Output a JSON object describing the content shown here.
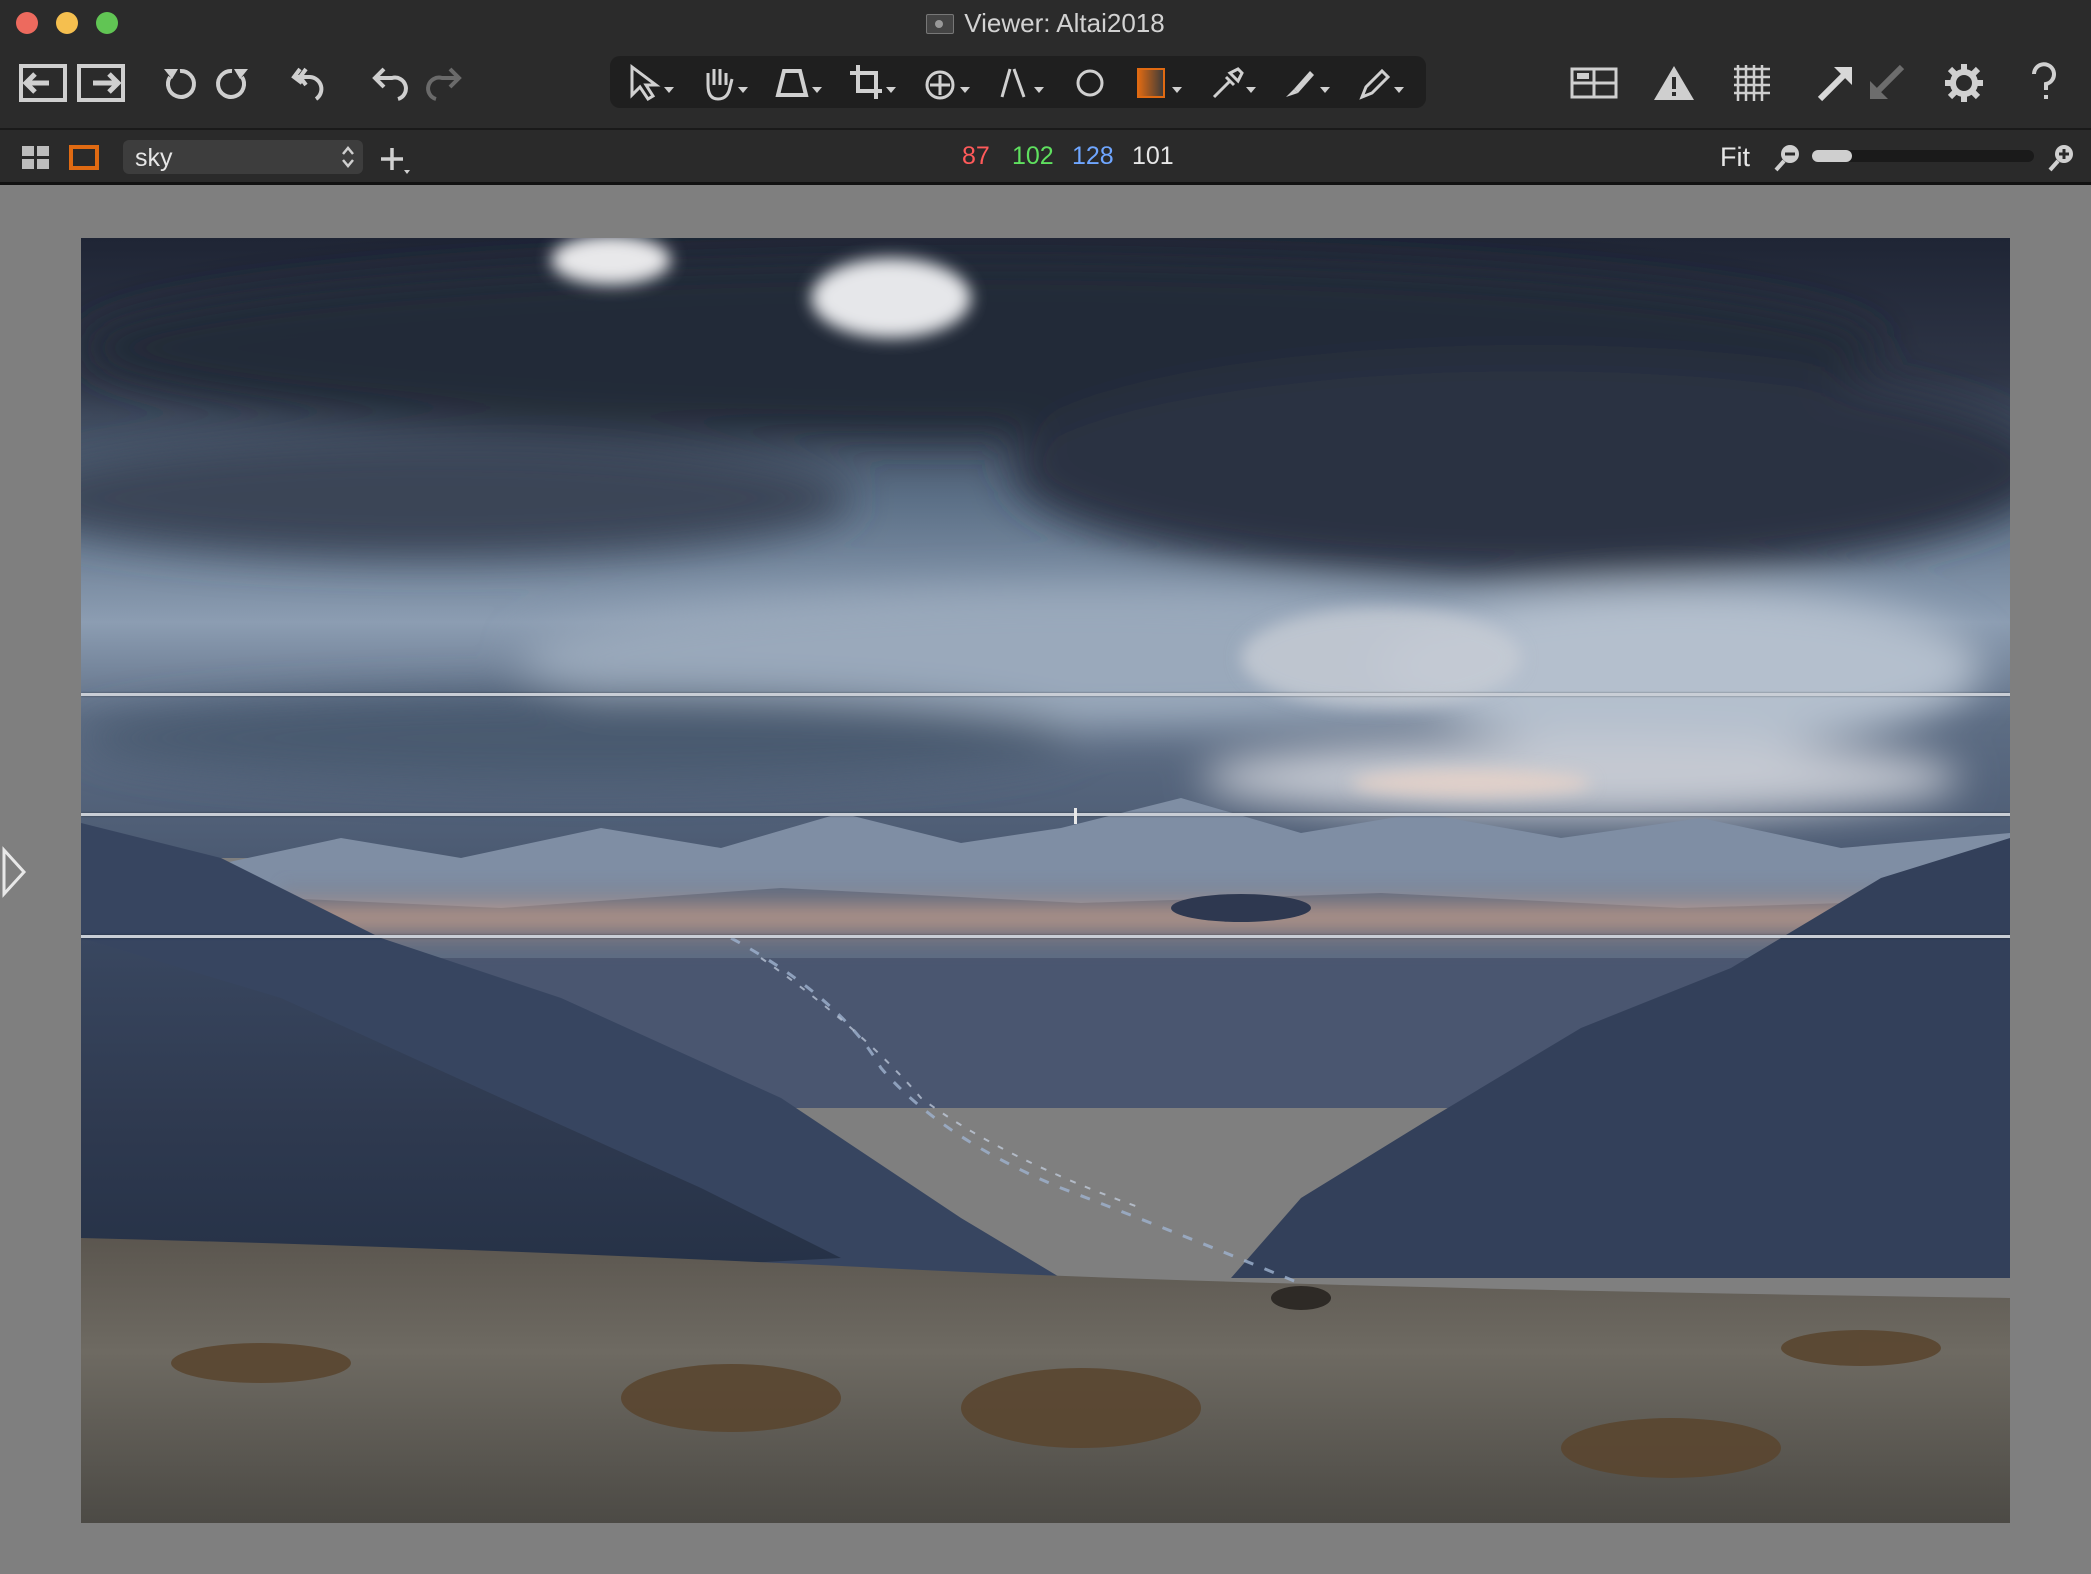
{
  "window": {
    "title": "Viewer: Altai2018"
  },
  "toolbar": {
    "left_buttons": [
      "import-icon",
      "export-icon",
      "rotate-left-icon",
      "rotate-right-icon",
      "reset-icon",
      "undo-icon",
      "redo-icon"
    ],
    "tools": [
      "select-tool-icon",
      "pan-tool-icon",
      "keystone-tool-icon",
      "crop-tool-icon",
      "rotate-tool-icon",
      "straighten-tool-icon",
      "spot-tool-icon",
      "gradient-mask-icon",
      "color-picker-icon",
      "brush-icon",
      "eraser-icon"
    ],
    "right_buttons": [
      "compare-icon",
      "exposure-warning-icon",
      "grid-icon",
      "copy-adjustments-icon",
      "apply-adjustments-icon",
      "settings-gear-icon",
      "help-icon"
    ],
    "accent_color": "#e06a12"
  },
  "subbar": {
    "layer": "sky",
    "rgb": {
      "r": "87",
      "g": "102",
      "b": "128",
      "l": "101"
    },
    "zoom_label": "Fit",
    "zoom_level": 0.08
  },
  "viewer": {
    "image_subject": "mountain valley under storm clouds"
  }
}
